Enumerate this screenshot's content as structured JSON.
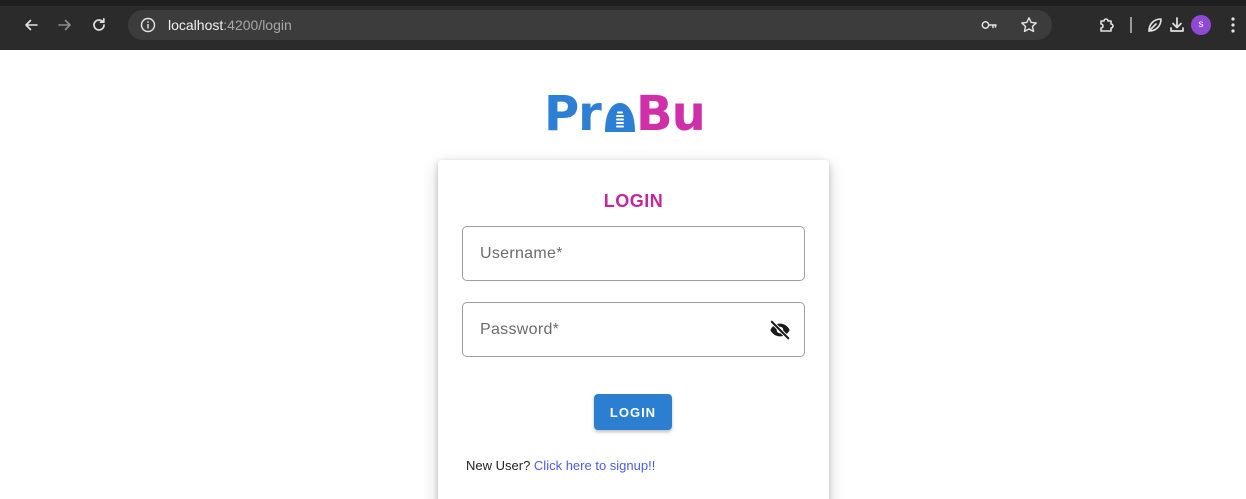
{
  "browser": {
    "url_host": "localhost",
    "url_path": ":4200/login",
    "profile_initial": "s"
  },
  "logo": {
    "part1": "Pr",
    "part2": "Bu",
    "colors": {
      "part1": "#2d7fd3",
      "part2": "#cf2fa8"
    }
  },
  "login": {
    "title": "LOGIN",
    "username_placeholder": "Username*",
    "password_placeholder": "Password*",
    "button_label": "LOGIN",
    "new_user_text": "New User? ",
    "signup_link_text": "Click here to signup!!"
  },
  "colors": {
    "accent_blue": "#2c7fd0",
    "title_magenta": "#c2289b",
    "link": "#4d5be0"
  },
  "icons": {
    "back": "arrow-left-icon",
    "forward": "arrow-right-icon",
    "reload": "reload-icon",
    "site_info": "info-icon",
    "password_manager": "key-icon",
    "bookmark": "star-icon",
    "extensions": "puzzle-icon",
    "performance": "leaf-icon",
    "downloads": "download-icon",
    "menu": "kebab-menu-icon",
    "visibility": "eye-off-icon"
  }
}
